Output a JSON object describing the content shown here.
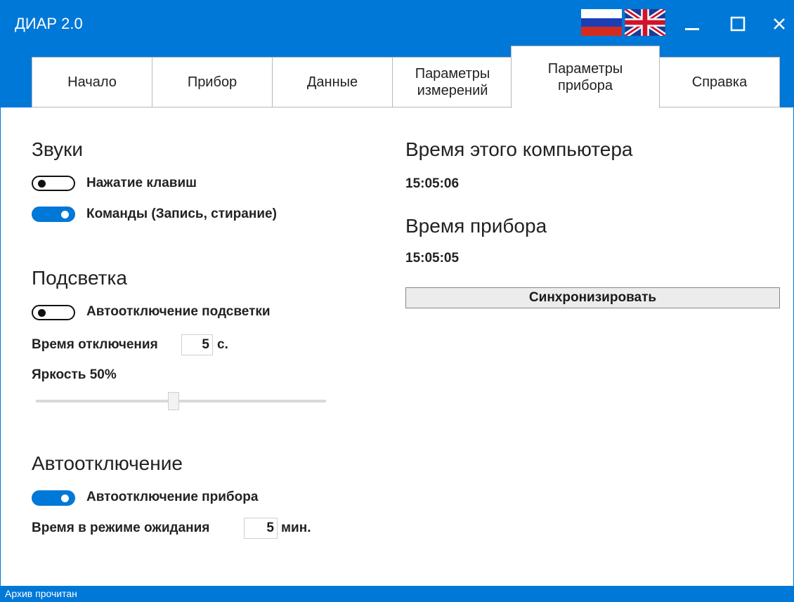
{
  "window": {
    "title": "ДИАР 2.0"
  },
  "tabs": [
    {
      "label": "Начало"
    },
    {
      "label": "Прибор"
    },
    {
      "label": "Данные"
    },
    {
      "label": "Параметры измерений"
    },
    {
      "label": "Параметры прибора",
      "active": true
    },
    {
      "label": "Справка"
    }
  ],
  "sounds": {
    "title": "Звуки",
    "key_press": {
      "label": "Нажатие клавиш",
      "on": false
    },
    "commands": {
      "label": "Команды (Запись, стирание)",
      "on": true
    }
  },
  "backlight": {
    "title": "Подсветка",
    "auto_off": {
      "label": "Автоотключение подсветки",
      "on": false
    },
    "off_time_label": "Время отключения",
    "off_time_value": "5",
    "off_time_unit": "с.",
    "brightness_label": "Яркость 50%",
    "brightness_level": 0.5
  },
  "auto_shutdown": {
    "title": "Автоотключение",
    "device_auto_off": {
      "label": "Автоотключение прибора",
      "on": true
    },
    "standby_label": "Время в режиме ожидания",
    "standby_value": "5",
    "standby_unit": "мин."
  },
  "time": {
    "computer_title": "Время этого компьютера",
    "computer_time": "15:05:06",
    "device_title": "Время прибора",
    "device_time": "15:05:05",
    "sync_label": "Синхронизировать"
  },
  "status": {
    "text": "Архив прочитан"
  },
  "icons": {
    "flag_ru": "russian-flag-icon",
    "flag_uk": "uk-flag-icon",
    "minimize": "minimize-icon",
    "maximize": "maximize-icon",
    "close": "close-icon"
  },
  "colors": {
    "accent": "#0078d7"
  }
}
